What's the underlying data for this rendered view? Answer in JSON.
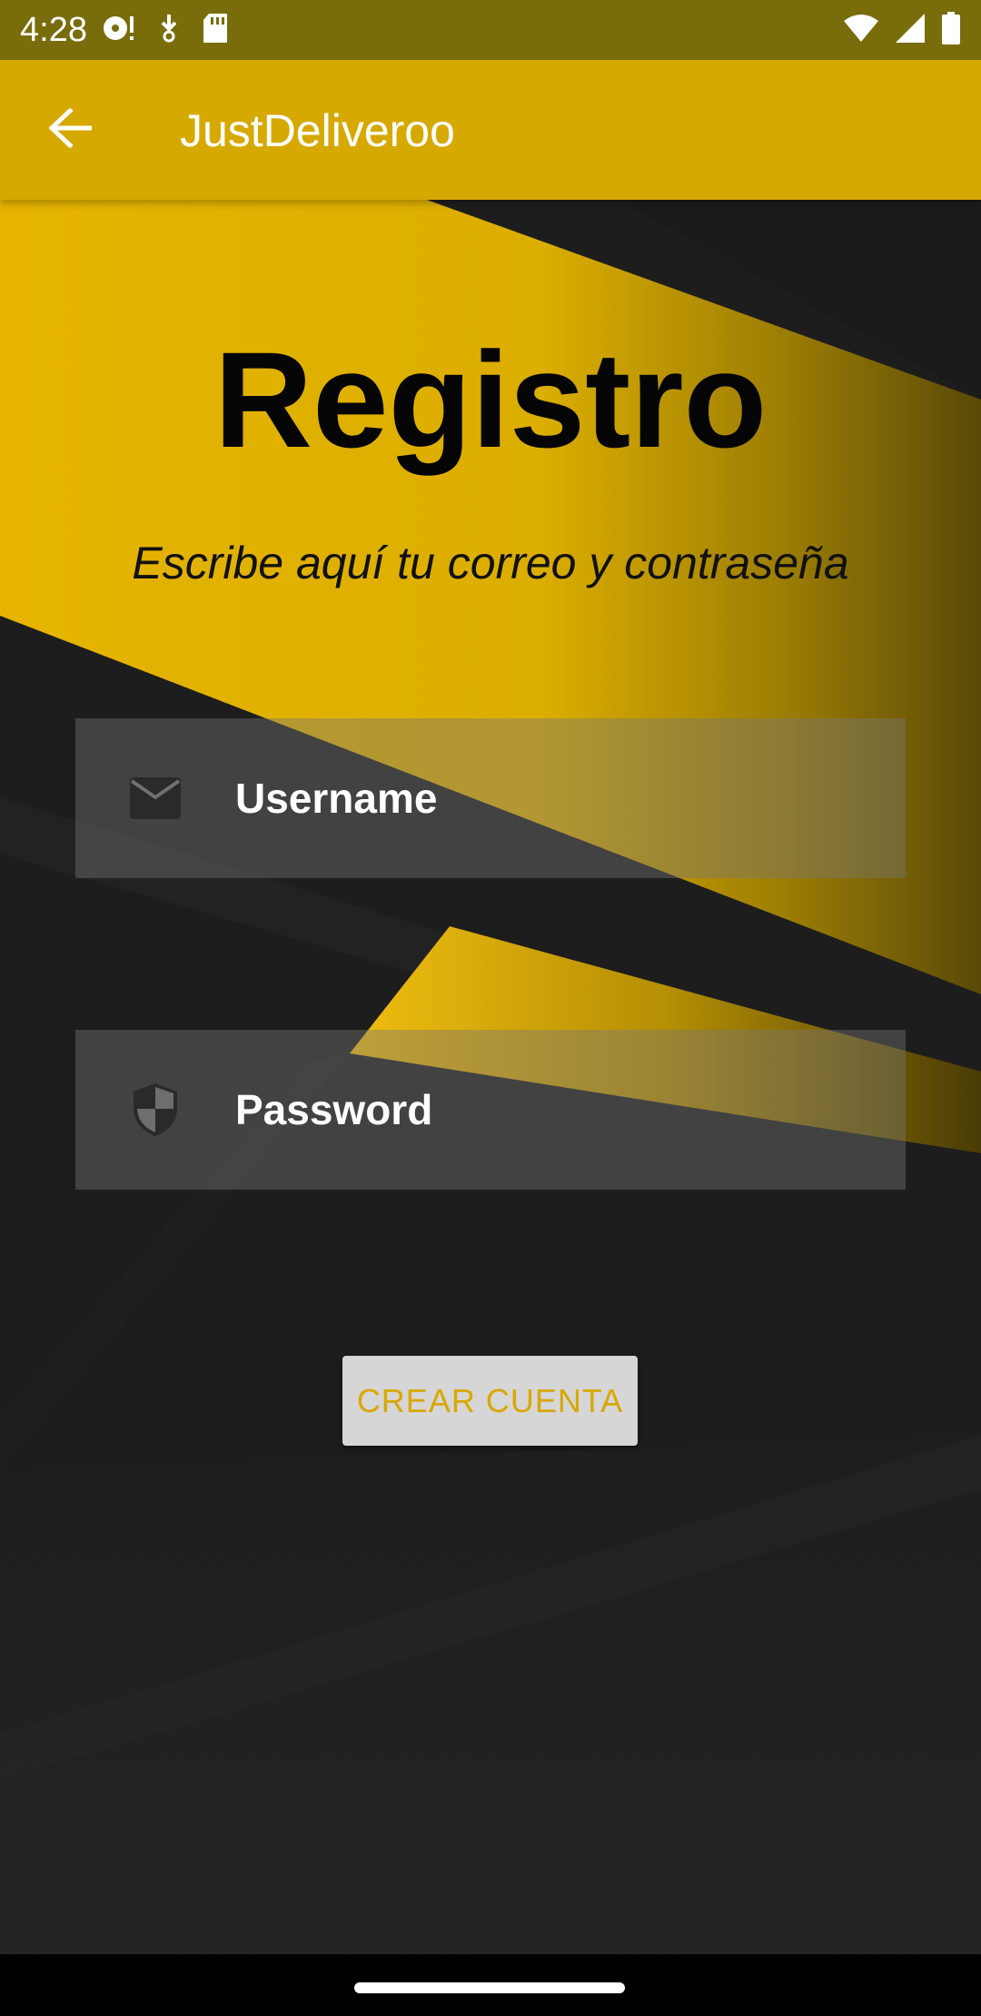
{
  "status_bar": {
    "time": "4:28",
    "left_icons": [
      "media-notification-icon",
      "download-notification-icon",
      "sd-card-icon"
    ],
    "right_icons": [
      "wifi-icon",
      "signal-icon",
      "battery-icon"
    ]
  },
  "app_bar": {
    "back_icon": "arrow-back-icon",
    "title": "JustDeliveroo"
  },
  "main": {
    "title": "Registro",
    "subtitle": "Escribe aquí tu correo y contraseña",
    "username": {
      "icon": "email-icon",
      "placeholder": "Username",
      "value": ""
    },
    "password": {
      "icon": "shield-icon",
      "placeholder": "Password",
      "value": ""
    },
    "create_button_label": "CREAR CUENTA"
  },
  "colors": {
    "status_bar": "#796c0b",
    "app_bar": "#d6a900",
    "accent": "#d8a800",
    "background": "#1e1e1e",
    "button_bg": "#d6d6d6"
  }
}
